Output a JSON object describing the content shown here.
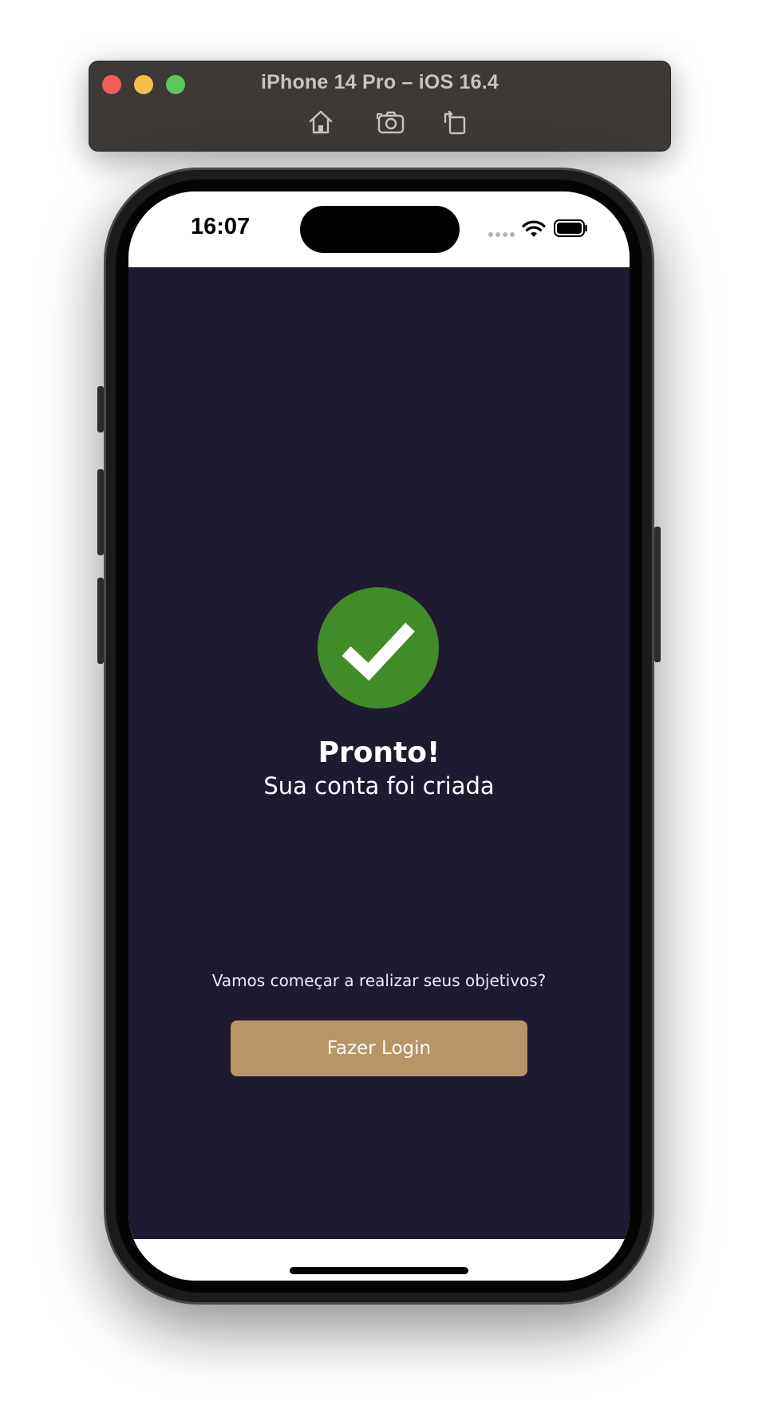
{
  "simulator": {
    "title": "iPhone 14 Pro – iOS 16.4",
    "toolbar": {
      "home_icon": "home-icon",
      "screenshot_icon": "camera-icon",
      "rotate_icon": "rotate-icon"
    }
  },
  "status_bar": {
    "time": "16:07",
    "wifi_icon": "wifi-icon",
    "battery_icon": "battery-icon"
  },
  "success": {
    "icon": "checkmark-icon",
    "title": "Pronto!",
    "subtitle": "Sua conta foi criada"
  },
  "cta": {
    "prompt": "Vamos começar a realizar seus objetivos?",
    "button_label": "Fazer Login"
  },
  "colors": {
    "background": "#1e1b31",
    "success_green": "#418b2a",
    "button_gold": "#b79566"
  }
}
